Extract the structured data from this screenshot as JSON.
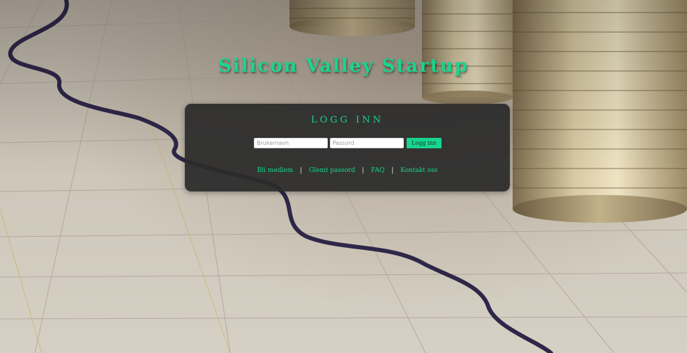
{
  "site": {
    "title": "Silicon Valley Startup"
  },
  "login": {
    "heading": "LOGG INN",
    "username_placeholder": "Brukernavn",
    "password_placeholder": "Passord",
    "button_label": "Logg inn"
  },
  "links": {
    "member": "Bli medlem",
    "forgot_password": "Glemt passord",
    "faq": "FAQ",
    "contact": "Kontakt oss",
    "separator": "|"
  },
  "colors": {
    "accent": "#17d68e",
    "panel": "#2c2c2c"
  },
  "background": {
    "icon": "coins-and-chart-photo"
  }
}
